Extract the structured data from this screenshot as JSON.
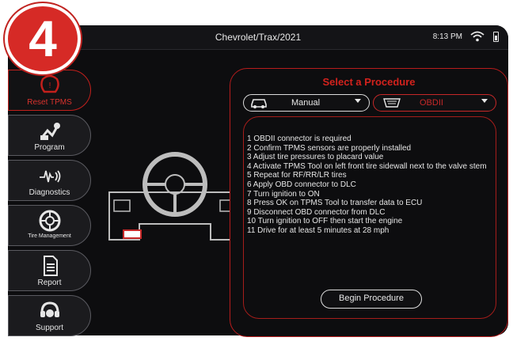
{
  "badge": {
    "number": "4"
  },
  "header": {
    "vehicle": "Chevrolet/Trax/2021",
    "time": "8:13 PM"
  },
  "sidebar": {
    "items": [
      {
        "label": "Reset TPMS",
        "icon": "tpms-reset-icon",
        "active": true
      },
      {
        "label": "Program",
        "icon": "program-icon"
      },
      {
        "label": "Diagnostics",
        "icon": "diagnostics-icon"
      },
      {
        "label": "Tire Management",
        "icon": "tire-icon"
      },
      {
        "label": "Report",
        "icon": "report-icon"
      },
      {
        "label": "Support",
        "icon": "support-icon"
      }
    ]
  },
  "main": {
    "title": "Select a Procedure",
    "manual_select": {
      "value": "Manual"
    },
    "obd_select": {
      "value": "OBDII"
    },
    "steps": [
      "1 OBDII connector is required",
      "2 Confirm TPMS sensors are properly installed",
      "3 Adjust tire pressures to placard value",
      "4 Activate TPMS Tool on left front tire sidewall next to the valve stem",
      "5 Repeat for RF/RR/LR tires",
      "6 Apply OBD connector to DLC",
      "7 Turn ignition to ON",
      "8 Press OK on TPMS Tool to transfer data to ECU",
      "9 Disconnect OBD connector from DLC",
      "10 Turn ignition to OFF then start the engine",
      "11 Drive for at least 5 minutes at 28 mph"
    ],
    "begin_label": "Begin Procedure"
  },
  "colors": {
    "accent": "#d3221d",
    "background": "#0d0d0f",
    "badge": "#d62a26"
  }
}
